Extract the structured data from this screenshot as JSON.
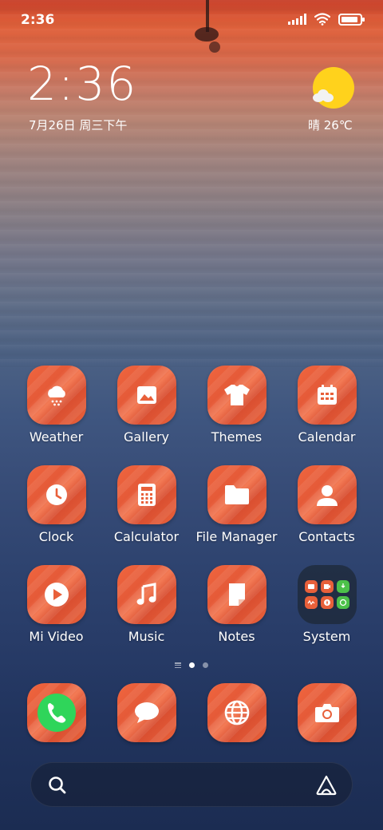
{
  "status_bar": {
    "time": "2:36",
    "signal_bars": 5,
    "battery_level": 0.9,
    "icons": [
      "signal-icon",
      "wifi-icon",
      "battery-icon"
    ]
  },
  "clock_widget": {
    "time": "2:36",
    "date": "7月26日 周三下午"
  },
  "weather_widget": {
    "condition_icon": "sun-cloud-icon",
    "text": "晴 26℃"
  },
  "apps": [
    {
      "label": "Weather",
      "icon": "weather-icon"
    },
    {
      "label": "Gallery",
      "icon": "gallery-icon"
    },
    {
      "label": "Themes",
      "icon": "themes-icon"
    },
    {
      "label": "Calendar",
      "icon": "calendar-icon"
    },
    {
      "label": "Clock",
      "icon": "clock-icon"
    },
    {
      "label": "Calculator",
      "icon": "calculator-icon"
    },
    {
      "label": "File Manager",
      "icon": "folder-icon"
    },
    {
      "label": "Contacts",
      "icon": "contacts-icon"
    },
    {
      "label": "Mi Video",
      "icon": "video-icon"
    },
    {
      "label": "Music",
      "icon": "music-icon"
    },
    {
      "label": "Notes",
      "icon": "notes-icon"
    },
    {
      "label": "System",
      "icon": "folder-group-icon"
    }
  ],
  "page_indicator": {
    "current": 1,
    "total": 2
  },
  "dock": [
    {
      "icon": "phone-icon"
    },
    {
      "icon": "messages-icon"
    },
    {
      "icon": "browser-icon"
    },
    {
      "icon": "camera-icon"
    }
  ],
  "search_bar": {
    "icon": "search-icon",
    "assistant_icon": "assistant-icon"
  },
  "colors": {
    "icon_accent": "#e8603a",
    "sun": "#ffd21c",
    "phone_green": "#2fd55a"
  }
}
